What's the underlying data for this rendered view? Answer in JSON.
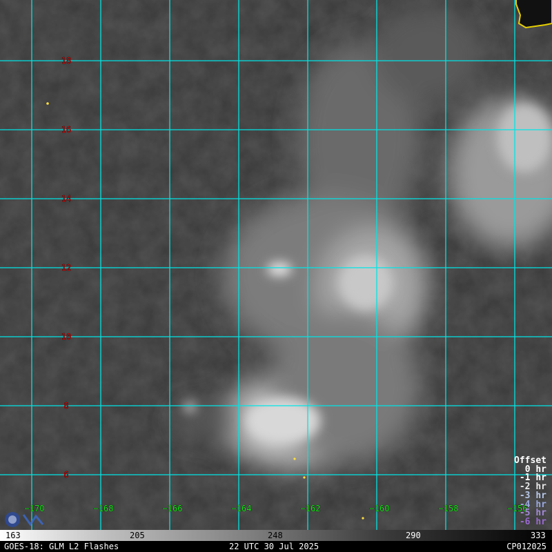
{
  "map": {
    "latitude_labels": [
      "18",
      "16",
      "14",
      "12",
      "10",
      "8",
      "6"
    ],
    "longitude_labels": [
      "−170",
      "−168",
      "−166",
      "−164",
      "−162",
      "−160",
      "−158",
      "−156"
    ],
    "grid_color": "#00e5e5",
    "lat_label_color": "#e00000",
    "lon_label_color": "#18e818",
    "coastline_color": "#e8d000"
  },
  "legend": {
    "title": "Offset",
    "entries": [
      {
        "label": "0 hr",
        "color": "#ffffff"
      },
      {
        "label": "-1 hr",
        "color": "#ffffff"
      },
      {
        "label": "-2 hr",
        "color": "#e8e8e8"
      },
      {
        "label": "-3 hr",
        "color": "#b8c8e8"
      },
      {
        "label": "-4 hr",
        "color": "#9aa8e0"
      },
      {
        "label": "-5 hr",
        "color": "#a48ad8"
      },
      {
        "label": "-6 hr",
        "color": "#9a6ad0"
      }
    ]
  },
  "colorbar": {
    "ticks": [
      "163",
      "205",
      "248",
      "290",
      "333"
    ]
  },
  "footer": {
    "left": "GOES-18: GLM L2 Flashes",
    "center": "22 UTC 30 Jul 2025",
    "right": "CP012025"
  }
}
